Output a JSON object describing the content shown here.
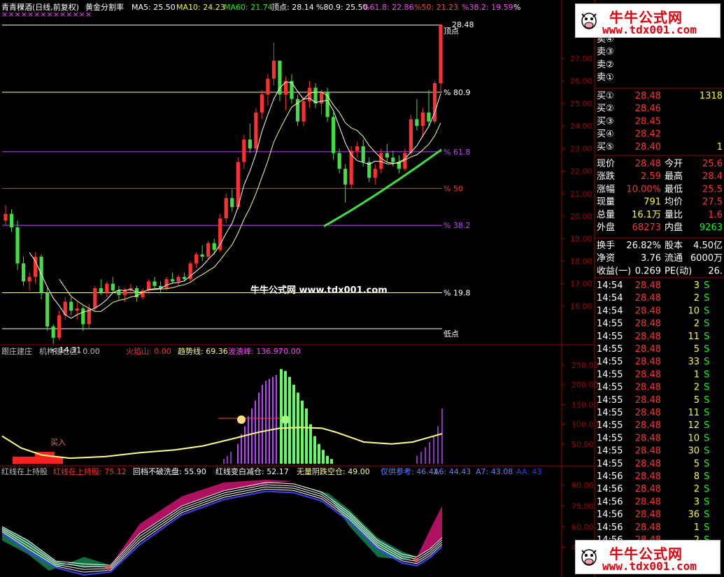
{
  "header": {
    "title": "青青稞酒(日线,前复权)",
    "indicator": "黄金分割率",
    "items": [
      {
        "label": "MA5: 25.50",
        "color": "#ffffff"
      },
      {
        "label": "MA10: 24.23",
        "color": "#ffff00"
      },
      {
        "label": "MA60: 21.74",
        "color": "#00ff00"
      },
      {
        "label": "顶点: 28.14",
        "color": "#ffffff"
      },
      {
        "label": "%80.9: 25.50",
        "color": "#ffffff"
      },
      {
        "label": "%61.8: 22.86",
        "color": "#ff40ff"
      },
      {
        "label": "%50: 21.23",
        "color": "#ff4040"
      },
      {
        "label": "%38.2: 19.59",
        "color": "#ff40ff"
      },
      {
        "label": "%",
        "color": "#ffffff"
      }
    ]
  },
  "main_panel": {
    "fib_labels": {
      "top": "28.48",
      "top_sub": "顶点",
      "f809": "80.9",
      "f618": "61.8",
      "f50": "50",
      "f382": "38.2",
      "f198": "19.8",
      "bottom": "低点",
      "low_mark": "14.31"
    },
    "y_axis": [
      "27.00",
      "26.00",
      "25.00",
      "24.00",
      "23.00",
      "22.00",
      "21.00",
      "20.00",
      "19.00",
      "18.00",
      "17.00",
      "16.00"
    ],
    "watermark": "牛牛公式网 www.tdx001.com"
  },
  "panel2": {
    "header_items": [
      {
        "label": "跟庄建庄",
        "color": "#c0c0c0"
      },
      {
        "label": "机构建仓区: 0.00",
        "color": "#c0c0c0"
      },
      {
        "label": "火焰山: 0.00",
        "color": "#ff3030"
      },
      {
        "label": "趋势线: 69.36",
        "color": "#ffff80"
      },
      {
        "label": "波浪峰: 136.97",
        "color": "#ff40ff"
      },
      {
        "label": ": 0.00",
        "color": "#ff40ff"
      }
    ],
    "buy_label": "买入",
    "y_axis": [
      "250.00",
      "200.00",
      "150.00",
      "100.00",
      "50.00"
    ]
  },
  "panel3": {
    "header_items": [
      {
        "label": "红线在上持股",
        "color": "#c0c0c0"
      },
      {
        "label": "红线在上持股: 75.12",
        "color": "#ff3030"
      },
      {
        "label": "回档不破洗盘: 55.90",
        "color": "#ffffff"
      },
      {
        "label": "红线变白减仓: 52.17",
        "color": "#ffffff"
      },
      {
        "label": "无量阴跌空仓: 49.00",
        "color": "#ffff80"
      },
      {
        "label": "仅供参考: 46.41",
        "color": "#6080ff"
      },
      {
        "label": "A6: 44.43",
        "color": "#6080ff"
      },
      {
        "label": "A7: 43.08",
        "color": "#6080ff"
      },
      {
        "label": "AA: 43",
        "color": "#2040ff"
      }
    ],
    "y_axis": [
      "90.00",
      "75.00",
      "60.00",
      "45.00"
    ]
  },
  "quote": {
    "sell": [
      {
        "label": "卖④",
        "price": "",
        "vol": ""
      },
      {
        "label": "卖③",
        "price": "",
        "vol": ""
      },
      {
        "label": "卖②",
        "price": "",
        "vol": ""
      },
      {
        "label": "卖①",
        "price": "",
        "vol": ""
      }
    ],
    "buy": [
      {
        "label": "买①",
        "price": "28.48",
        "vol": "1318"
      },
      {
        "label": "买②",
        "price": "28.46",
        "vol": ""
      },
      {
        "label": "买③",
        "price": "28.45",
        "vol": ""
      },
      {
        "label": "买④",
        "price": "28.42",
        "vol": ""
      },
      {
        "label": "买⑤",
        "price": "28.40",
        "vol": "1"
      }
    ],
    "stats": [
      {
        "l1": "现价",
        "v1": "28.48",
        "c1": "#ff3030",
        "l2": "今开",
        "v2": "25.6",
        "c2": "#ff3030"
      },
      {
        "l1": "涨跌",
        "v1": "2.59",
        "c1": "#ff3030",
        "l2": "最高",
        "v2": "28.4",
        "c2": "#ff3030"
      },
      {
        "l1": "涨幅",
        "v1": "10.00%",
        "c1": "#ff3030",
        "l2": "最低",
        "v2": "25.5",
        "c2": "#ff3030"
      },
      {
        "l1": "现量",
        "v1": "791",
        "c1": "#ffff00",
        "l2": "均价",
        "v2": "27.5",
        "c2": "#ff3030"
      },
      {
        "l1": "总量",
        "v1": "16.1万",
        "c1": "#ffff00",
        "l2": "量比",
        "v2": "1.6",
        "c2": "#ff3030"
      },
      {
        "l1": "外盘",
        "v1": "68273",
        "c1": "#ff3030",
        "l2": "内盘",
        "v2": "9263",
        "c2": "#00ff00"
      }
    ],
    "stats2": [
      {
        "l1": "换手",
        "v1": "26.82%",
        "l2": "股本",
        "v2": "4.50亿"
      },
      {
        "l1": "净资",
        "v1": "3.76",
        "l2": "流通",
        "v2": "6000万"
      },
      {
        "l1": "收益(一)",
        "v1": "0.269",
        "l2": "PE(动)",
        "v2": "26."
      }
    ],
    "ticks": [
      {
        "t": "14:54",
        "p": "28.48",
        "v": "3",
        "s": "S"
      },
      {
        "t": "14:54",
        "p": "28.48",
        "v": "2",
        "s": "S"
      },
      {
        "t": "14:54",
        "p": "28.48",
        "v": "10",
        "s": "S"
      },
      {
        "t": "14:55",
        "p": "28.48",
        "v": "2",
        "s": "S"
      },
      {
        "t": "14:55",
        "p": "28.48",
        "v": "11",
        "s": "S"
      },
      {
        "t": "14:55",
        "p": "28.48",
        "v": "5",
        "s": "S"
      },
      {
        "t": "14:55",
        "p": "28.48",
        "v": "33",
        "s": "S"
      },
      {
        "t": "14:55",
        "p": "28.48",
        "v": "1",
        "s": "S"
      },
      {
        "t": "14:55",
        "p": "28.48",
        "v": "2",
        "s": "S"
      },
      {
        "t": "14:55",
        "p": "28.48",
        "v": "5",
        "s": "S"
      },
      {
        "t": "14:55",
        "p": "28.48",
        "v": "11",
        "s": "S"
      },
      {
        "t": "14:55",
        "p": "28.48",
        "v": "12",
        "s": "S"
      },
      {
        "t": "14:55",
        "p": "28.48",
        "v": "10",
        "s": "S"
      },
      {
        "t": "14:55",
        "p": "28.48",
        "v": "30",
        "s": "S"
      },
      {
        "t": "14:55",
        "p": "28.48",
        "v": "5",
        "s": "S"
      },
      {
        "t": "14:56",
        "p": "28.48",
        "v": "8",
        "s": "S"
      },
      {
        "t": "14:56",
        "p": "28.48",
        "v": "2",
        "s": "S"
      },
      {
        "t": "14:56",
        "p": "28.48",
        "v": "3",
        "s": "S"
      },
      {
        "t": "14:56",
        "p": "28.48",
        "v": "36",
        "s": "S"
      },
      {
        "t": "14:56",
        "p": "28.48",
        "v": "1",
        "s": "S"
      },
      {
        "t": "14:56",
        "p": "28.48",
        "v": "2",
        "s": "S"
      }
    ]
  },
  "ads": {
    "name": "牛牛公式网",
    "url": "www.tdx001.com"
  },
  "chart_data": {
    "type": "candlestick",
    "title": "青青稞酒(日线,前复权)",
    "fib_levels": {
      "顶点": 28.14,
      "80.9": 25.5,
      "61.8": 22.86,
      "50": 21.23,
      "38.2": 19.59
    },
    "high": 28.48,
    "low": 14.31,
    "ma": {
      "MA5": 25.5,
      "MA10": 24.23,
      "MA60": 21.74
    },
    "ylim": [
      15.0,
      28.6
    ],
    "candles": [
      [
        19.8,
        20.5,
        19.6,
        20.1
      ],
      [
        20.1,
        20.3,
        19.3,
        19.5
      ],
      [
        19.5,
        19.8,
        17.6,
        17.9
      ],
      [
        17.9,
        18.2,
        16.9,
        17.1
      ],
      [
        17.1,
        17.5,
        16.7,
        17.3
      ],
      [
        17.3,
        18.4,
        17.0,
        18.2
      ],
      [
        18.2,
        18.3,
        16.3,
        16.6
      ],
      [
        16.6,
        16.8,
        14.9,
        15.1
      ],
      [
        15.1,
        15.2,
        14.31,
        14.6
      ],
      [
        14.6,
        15.8,
        14.5,
        15.6
      ],
      [
        15.6,
        16.4,
        15.4,
        16.2
      ],
      [
        16.2,
        16.4,
        15.6,
        15.8
      ],
      [
        15.8,
        16.2,
        15.4,
        15.9
      ],
      [
        15.9,
        16.0,
        14.9,
        15.2
      ],
      [
        15.2,
        16.1,
        15.0,
        15.9
      ],
      [
        15.9,
        16.9,
        15.8,
        16.8
      ],
      [
        16.8,
        17.2,
        16.5,
        16.6
      ],
      [
        16.6,
        17.1,
        16.4,
        17.0
      ],
      [
        17.0,
        17.3,
        16.6,
        16.7
      ],
      [
        16.7,
        16.9,
        16.3,
        16.5
      ],
      [
        16.5,
        16.8,
        16.2,
        16.7
      ],
      [
        16.7,
        17.0,
        16.5,
        16.8
      ],
      [
        16.8,
        16.9,
        16.2,
        16.4
      ],
      [
        16.4,
        16.8,
        16.3,
        16.7
      ],
      [
        16.7,
        17.2,
        16.6,
        17.1
      ],
      [
        17.1,
        17.3,
        16.8,
        16.9
      ],
      [
        16.9,
        17.1,
        16.6,
        16.8
      ],
      [
        16.8,
        17.3,
        16.7,
        17.2
      ],
      [
        17.2,
        17.5,
        17.0,
        17.1
      ],
      [
        17.1,
        17.4,
        16.9,
        17.3
      ],
      [
        17.3,
        17.5,
        17.1,
        17.2
      ],
      [
        17.2,
        18.0,
        17.1,
        17.9
      ],
      [
        17.9,
        18.4,
        17.7,
        18.3
      ],
      [
        18.3,
        18.7,
        18.0,
        18.2
      ],
      [
        18.2,
        18.9,
        18.1,
        18.8
      ],
      [
        18.8,
        19.0,
        18.3,
        18.5
      ],
      [
        18.5,
        20.1,
        18.4,
        19.9
      ],
      [
        19.9,
        21.0,
        19.7,
        20.8
      ],
      [
        20.8,
        21.2,
        20.2,
        20.4
      ],
      [
        20.4,
        22.6,
        20.3,
        22.4
      ],
      [
        22.4,
        23.6,
        22.1,
        23.4
      ],
      [
        23.4,
        24.1,
        22.8,
        23.0
      ],
      [
        23.0,
        24.8,
        22.9,
        24.6
      ],
      [
        24.6,
        25.6,
        24.3,
        25.4
      ],
      [
        25.4,
        26.3,
        24.9,
        26.1
      ],
      [
        26.1,
        27.7,
        25.8,
        26.9
      ],
      [
        26.9,
        26.8,
        25.1,
        25.4
      ],
      [
        25.4,
        26.2,
        24.7,
        26.0
      ],
      [
        26.0,
        26.3,
        25.0,
        25.2
      ],
      [
        25.2,
        25.4,
        24.0,
        24.2
      ],
      [
        24.2,
        25.3,
        24.0,
        25.1
      ],
      [
        25.1,
        26.0,
        24.8,
        25.7
      ],
      [
        25.7,
        25.9,
        24.8,
        25.0
      ],
      [
        25.0,
        25.6,
        24.5,
        25.5
      ],
      [
        25.5,
        25.7,
        24.2,
        24.4
      ],
      [
        24.4,
        24.6,
        22.5,
        22.8
      ],
      [
        22.8,
        23.0,
        21.9,
        22.1
      ],
      [
        22.1,
        22.3,
        20.6,
        21.4
      ],
      [
        21.4,
        23.1,
        21.2,
        22.9
      ],
      [
        22.9,
        23.3,
        22.6,
        23.1
      ],
      [
        23.1,
        23.4,
        22.2,
        22.4
      ],
      [
        22.4,
        22.6,
        21.5,
        21.7
      ],
      [
        21.7,
        22.3,
        21.4,
        22.1
      ],
      [
        22.1,
        23.0,
        21.9,
        22.8
      ],
      [
        22.8,
        23.2,
        22.4,
        22.6
      ],
      [
        22.6,
        22.9,
        22.2,
        22.4
      ],
      [
        22.4,
        22.7,
        21.9,
        22.1
      ],
      [
        22.1,
        23.0,
        22.0,
        22.8
      ],
      [
        22.8,
        24.5,
        22.7,
        24.3
      ],
      [
        24.3,
        25.2,
        23.8,
        24.0
      ],
      [
        24.0,
        24.8,
        23.5,
        24.6
      ],
      [
        24.6,
        25.6,
        24.0,
        24.2
      ],
      [
        24.2,
        26.0,
        24.1,
        25.9
      ],
      [
        25.9,
        28.48,
        25.5,
        28.48
      ]
    ]
  }
}
